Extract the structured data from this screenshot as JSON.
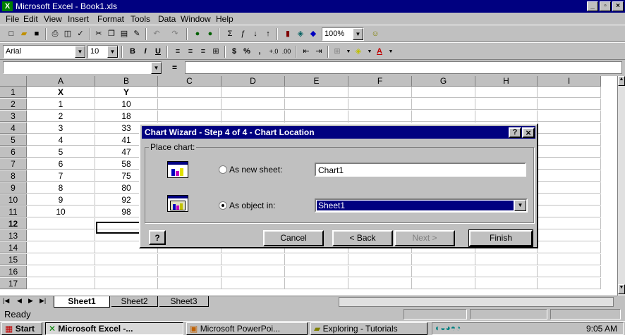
{
  "window": {
    "title": "Microsoft Excel - Book1.xls",
    "minimize": "_",
    "restore": "▫",
    "close": "×"
  },
  "menu": [
    "File",
    "Edit",
    "View",
    "Insert",
    "Format",
    "Tools",
    "Data",
    "Window",
    "Help"
  ],
  "toolbar": {
    "zoom": "100%",
    "font_name": "Arial",
    "font_size": "10",
    "bold": "B",
    "italic": "I",
    "underline": "U"
  },
  "formula_bar": {
    "name_box": "",
    "equals": "="
  },
  "grid": {
    "columns": [
      "A",
      "B",
      "C",
      "D",
      "E",
      "F",
      "G",
      "H",
      "I"
    ],
    "rows": [
      "1",
      "2",
      "3",
      "4",
      "5",
      "6",
      "7",
      "8",
      "9",
      "10",
      "11",
      "12",
      "13",
      "14",
      "15",
      "16",
      "17"
    ],
    "data": [
      [
        "X",
        "Y"
      ],
      [
        "1",
        "10"
      ],
      [
        "2",
        "18"
      ],
      [
        "3",
        "33"
      ],
      [
        "4",
        "41"
      ],
      [
        "5",
        "47"
      ],
      [
        "6",
        "58"
      ],
      [
        "7",
        "75"
      ],
      [
        "8",
        "80"
      ],
      [
        "9",
        "92"
      ],
      [
        "10",
        "98"
      ]
    ]
  },
  "dialog": {
    "title": "Chart Wizard - Step 4 of 4 - Chart Location",
    "help_glyph": "?",
    "close_glyph": "×",
    "group_label": "Place chart:",
    "option_new_sheet": "As new sheet:",
    "new_sheet_value": "Chart1",
    "option_object_in": "As object in:",
    "object_in_value": "Sheet1",
    "cancel": "Cancel",
    "back": "< Back",
    "next": "Next >",
    "finish": "Finish"
  },
  "sheets": [
    "Sheet1",
    "Sheet2",
    "Sheet3"
  ],
  "status": "Ready",
  "taskbar": {
    "start": "Start",
    "tasks": [
      "Microsoft Excel -...",
      "Microsoft PowerPoi...",
      "Exploring - Tutorials"
    ],
    "clock": "9:05 AM"
  }
}
